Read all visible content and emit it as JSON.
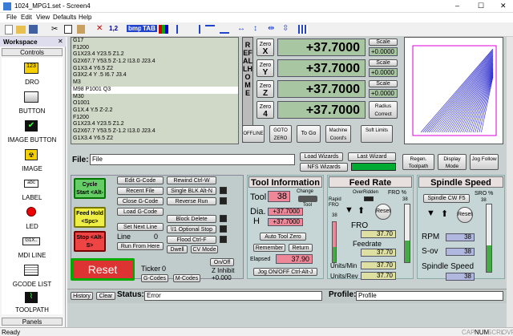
{
  "window": {
    "title": "1024_MPG1.set - Screen4",
    "min": "–",
    "max": "☐",
    "close": "✕"
  },
  "menu": [
    "File",
    "Edit",
    "View",
    "Defaults",
    "Help"
  ],
  "toolbar": {
    "t1": "1,2",
    "t2": "bmp",
    "t3": "TAB"
  },
  "workspace": {
    "title": "Workspace",
    "close": "✕",
    "controls": "Controls",
    "panels": "Panels",
    "items": [
      {
        "label": "DRO"
      },
      {
        "label": "BUTTON"
      },
      {
        "label": "IMAGE BUTTON"
      },
      {
        "label": "IMAGE"
      },
      {
        "label": "LABEL"
      },
      {
        "label": "LED"
      },
      {
        "label": "MDI LINE"
      },
      {
        "label": "GCODE LIST"
      },
      {
        "label": "TOOLPATH"
      }
    ]
  },
  "gcode": {
    "lines": [
      "G17",
      "F1200",
      "G1X23.4 Y23.5 Z1.2",
      "G2X67.7 Y53.5 Z-1.2 I13.0 J23.4",
      "G1X3.4 Y6.5 Z2",
      "G3X2.4 Y .5 I6.7 J3.4",
      "M3",
      "M98 P1001 Q3",
      "M30",
      "O1001",
      "G1X.4 Y.5 Z-2.2",
      "F1200",
      "G1X23.4 Y23.5 Z1.2",
      "G2X67.7 Y53.5 Z-1.2 I13.0 J23.4",
      "G1X3.4 Y6.5 Z2"
    ],
    "selected": 7
  },
  "refall": "REF ALL HOME",
  "axes": [
    {
      "zero": "Zero",
      "axis": "X",
      "value": "+37.7000",
      "scale": "Scale",
      "scale_value": "+0.0000"
    },
    {
      "zero": "Zero",
      "axis": "Y",
      "value": "+37.7000",
      "scale": "Scale",
      "scale_value": "+0.0000"
    },
    {
      "zero": "Zero",
      "axis": "Z",
      "value": "+37.7000",
      "scale": "Scale",
      "scale_value": "+0.0000"
    },
    {
      "zero": "Zero",
      "axis": "4",
      "value": "+37.7000",
      "radius": "Radius Correct"
    }
  ],
  "dro_buttons": {
    "offline": "OFFLINE",
    "goto_zero": "GOTO ZERO",
    "to_go": "To Go",
    "machine_coords": "Machine Coord's",
    "soft_limits": "Soft Limits"
  },
  "file": {
    "label": "File:",
    "value": "File"
  },
  "wizards": {
    "load": "Load Wizards",
    "last": "Last Wizard",
    "nfs": "NFS Wizards"
  },
  "view_buttons": {
    "regen": "Regen. Toolpath",
    "display": "Display Mode",
    "jog": "Jog Follow"
  },
  "run": {
    "cycle_start": "Cycle Start <Alt-R>",
    "feed_hold": "Feed Hold <Spc>",
    "stop": "Stop <Alt-S>",
    "reset": "Reset"
  },
  "gcode_buttons": {
    "edit": "Edit G-Code",
    "recent": "Recent File",
    "close": "Close G-Code",
    "load": "Load G-Code",
    "set_next": "Set Next Line",
    "line_label": "Line",
    "line_value": "0",
    "run_from_here": "Run From Here",
    "rewind": "Rewind Ctrl-W",
    "single_blk": "Single BLK Alt-N",
    "reverse_run": "Reverse Run",
    "block_delete": "Block Delete",
    "optional_stop": "\\!1 Optional Stop",
    "flood": "Flood Ctrl-F",
    "dwell": "Dwell",
    "cv_mode": "CV Mode"
  },
  "ticker": {
    "label": "Ticker",
    "value": "0",
    "gcodes": "G-Codes",
    "mcodes": "M-Codes",
    "onoff": "On/Off",
    "zinhibit": "Z Inhibit",
    "zinhibit_value": "+0.000"
  },
  "tool": {
    "title": "Tool Information",
    "tool_label": "Tool",
    "tool_value": "38",
    "change": "Change",
    "change2": "Tool",
    "dia_label": "Dia.",
    "dia_value": "+37.7000",
    "h_label": "H",
    "h_value": "+37.7000",
    "auto_zero": "Auto Tool Zero",
    "remember": "Remember",
    "return": "Return",
    "elapsed_label": "Elapsed",
    "elapsed_value": "37.90",
    "jog": "Jog ON/OFF Ctrl-Alt-J"
  },
  "feed": {
    "title": "Feed Rate",
    "override": "OverRidden",
    "rapid": "Rapid FRO",
    "rapid_value": "38",
    "fro_pct": "FRO %",
    "fro_pct_value": "38",
    "reset": "Reset",
    "fro_label": "FRO",
    "fro_value": "37.70",
    "feedrate_label": "Feedrate",
    "feedrate_value": "37.70",
    "upm_label": "Units/Min",
    "upm_value": "37.70",
    "upr_label": "Units/Rev",
    "upr_value": "37.70"
  },
  "spindle": {
    "title": "Spindle Speed",
    "cw": "Spindle CW F5",
    "sro": "SRO %",
    "sro_value": "38",
    "reset": "Reset",
    "rpm_label": "RPM",
    "rpm_value": "38",
    "sov_label": "S-ov",
    "sov_value": "38",
    "speed_label": "Spindle Speed",
    "speed_value": "38"
  },
  "status": {
    "history": "History",
    "clear": "Clear",
    "label": "Status:",
    "value": "Error",
    "profile_label": "Profile:",
    "profile_value": "Profile"
  },
  "statusbar": {
    "left": "Ready",
    "caps": "CAP",
    "num": "NUM",
    "scrl": "SCRL",
    "ovr": "OVR"
  }
}
